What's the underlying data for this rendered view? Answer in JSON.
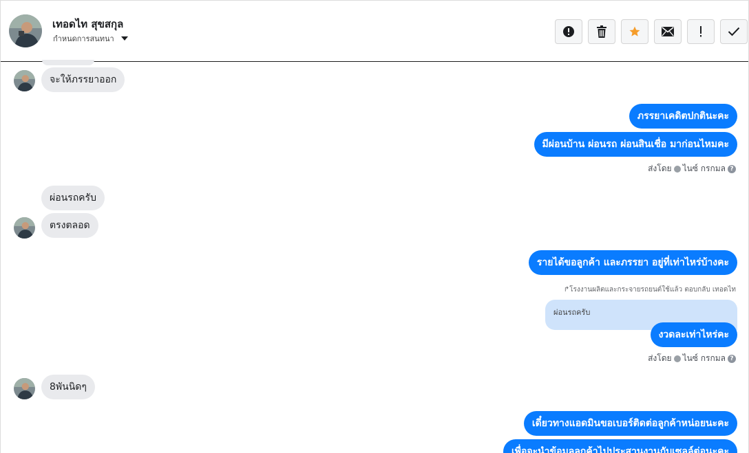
{
  "header": {
    "name": "เทอดไท สุขสกุล",
    "subtitle": "กำหนดการสนทนา",
    "actions": [
      {
        "name": "report-button",
        "icon": "alert-circle-icon"
      },
      {
        "name": "delete-button",
        "icon": "trash-icon"
      },
      {
        "name": "star-button",
        "icon": "star-icon"
      },
      {
        "name": "mail-button",
        "icon": "envelope-icon"
      },
      {
        "name": "important-button",
        "icon": "exclamation-icon"
      },
      {
        "name": "done-button",
        "icon": "checkmark-icon"
      }
    ]
  },
  "colors": {
    "outgoing": "#0a7cff",
    "incoming": "#e9eaed",
    "quote": "#cfe3fb",
    "star": "#f59c2a"
  },
  "messages": {
    "m1": "จะให้ภรรยาออก",
    "m2": "ภรรยาเคดิตปกตินะคะ",
    "m3": "มีผ่อนบ้าน ผ่อนรถ ผ่อนสินเชื่อ มาก่อนไหมคะ",
    "sent_by_1": "ส่งโดย",
    "sender_1": "ไนซ์ กรกมล",
    "m4": "ผ่อนรถครับ",
    "m5": "ตรงตลอด",
    "m6": "รายได้ขอลูกค้า และภรรยา อยู่ที่เท่าไหร่บ้างคะ",
    "reply_note": "↱โรงงานผลิตและกระจายรถยนต์ใช้แล้ว ตอบกลับ เทอดไท",
    "quoted": "ผ่อนรถครับ",
    "m7": "งวดละเท่าไหร่คะ",
    "sent_by_2": "ส่งโดย",
    "sender_2": "ไนซ์ กรกมล",
    "m8": "8พันนิดๆ",
    "m9": "เดี๋ยวทางแอดมินขอเบอร์ติดต่อลูกค้าหน่อยนะคะ",
    "m10": "เพื่อจะนำข้อมูลลูกค้าไปประสานงานกับเซลล์ต่อนะคะ"
  }
}
